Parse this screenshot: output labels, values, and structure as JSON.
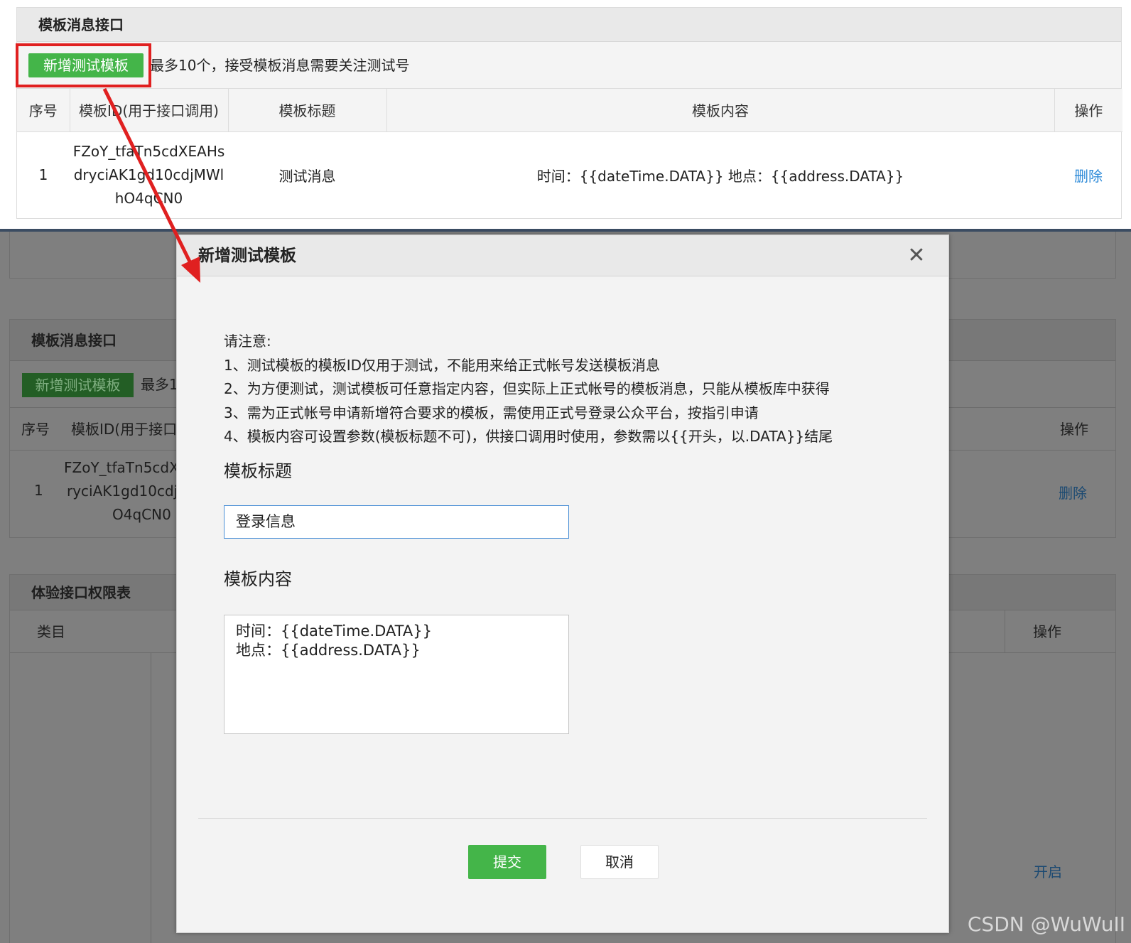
{
  "top_panel": {
    "title": "模板消息接口",
    "add_button": "新增测试模板",
    "tip": "最多10个，接受模板消息需要关注测试号",
    "columns": [
      "序号",
      "模板ID(用于接口调用)",
      "模板标题",
      "模板内容",
      "操作"
    ],
    "row": {
      "index": "1",
      "template_id": "FZoY_tfaTn5cdXEAHsdryciAK1gd10cdjMWlhO4qCN0",
      "template_title": "测试消息",
      "template_content": "时间：{{dateTime.DATA}} 地点：{{address.DATA}}",
      "action": "删除"
    }
  },
  "background": {
    "panel_title": "模板消息接口",
    "add_button": "新增测试模板",
    "tip_fragment": "最多1",
    "col_index": "序号",
    "col_id_fragment": "模板ID(用于接口",
    "col_action": "操作",
    "row_index": "1",
    "row_id_line1": "FZoY_tfaTn5cdX",
    "row_id_line2": "ryciAK1gd10cdj",
    "row_id_line3": "O4qCN0",
    "row_action": "删除",
    "perm_title": "体验接口权限表",
    "perm_col_category": "类目",
    "perm_col_action": "操作",
    "perm_link_open": "开启",
    "watermark": "CSDN @WuWuII"
  },
  "modal": {
    "title": "新增测试模板",
    "close_symbol": "✕",
    "notice_heading": "请注意:",
    "notices": [
      "1、测试模板的模板ID仅用于测试，不能用来给正式帐号发送模板消息",
      "2、为方便测试，测试模板可任意指定内容，但实际上正式帐号的模板消息，只能从模板库中获得",
      "3、需为正式帐号申请新增符合要求的模板，需使用正式号登录公众平台，按指引申请",
      "4、模板内容可设置参数(模板标题不可)，供接口调用时使用，参数需以{{开头，以.DATA}}结尾"
    ],
    "title_label": "模板标题",
    "title_value": "登录信息",
    "content_label": "模板内容",
    "content_line1": "时间：{{dateTime.DATA}}",
    "content_line2": "地点：{{address.DATA}}",
    "submit": "提交",
    "cancel": "取消"
  },
  "colors": {
    "primary_green": "#44b549",
    "highlight_red": "#e02020",
    "link_blue": "#2c8ad8"
  }
}
